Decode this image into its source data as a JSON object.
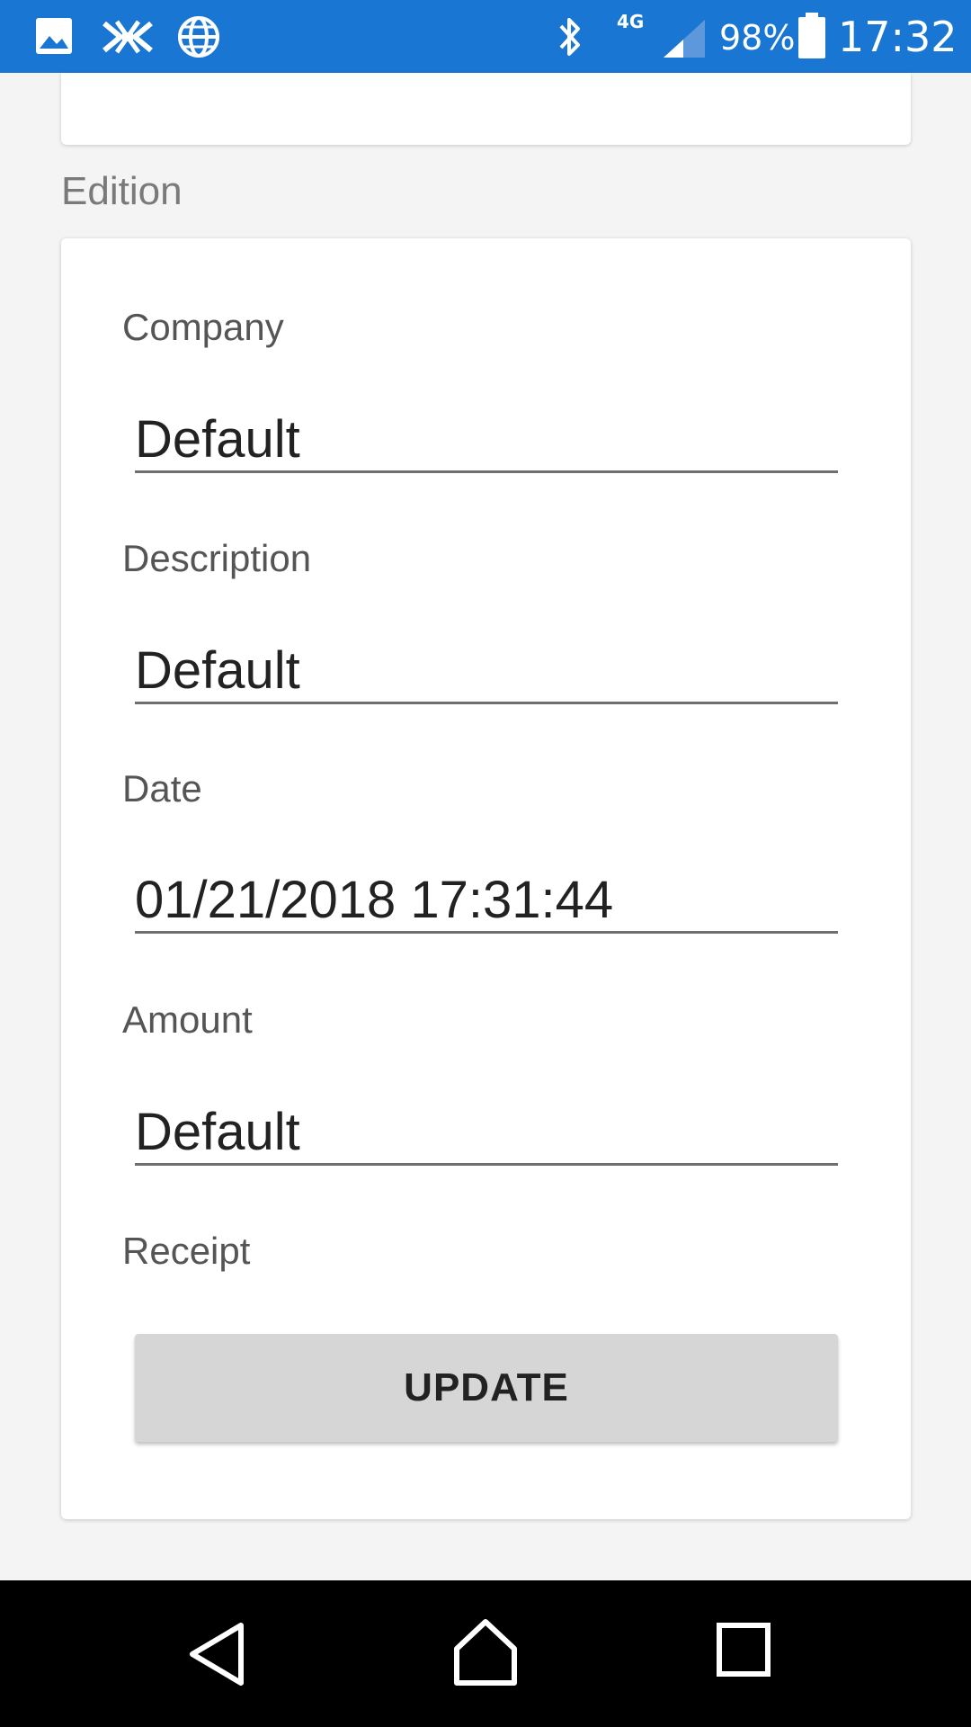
{
  "status_bar": {
    "network_type": "4G",
    "battery_percent": "98%",
    "battery_level": 0.98,
    "time": "17:32",
    "icons": [
      "gallery-icon",
      "app-notification-icon",
      "globe-icon",
      "bluetooth-icon",
      "signal-icon",
      "battery-icon"
    ]
  },
  "section": {
    "title": "Edition"
  },
  "form": {
    "company": {
      "label": "Company",
      "value": "Default"
    },
    "description": {
      "label": "Description",
      "value": "Default"
    },
    "date": {
      "label": "Date",
      "value": "01/21/2018 17:31:44"
    },
    "amount": {
      "label": "Amount",
      "value": "Default"
    },
    "receipt": {
      "label": "Receipt"
    },
    "update_button": "UPDATE"
  },
  "nav_bar": {
    "icons": [
      "back-icon",
      "home-icon",
      "recents-icon"
    ]
  },
  "colors": {
    "status_bar": "#1976d2",
    "background": "#f4f4f4",
    "button": "#d6d6d6"
  }
}
